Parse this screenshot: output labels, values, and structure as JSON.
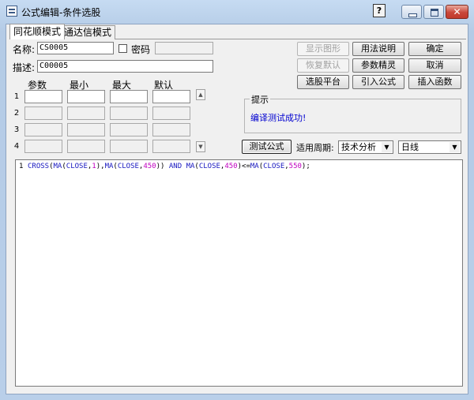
{
  "window": {
    "title": "公式编辑-条件选股",
    "help_label": "?",
    "close_label": "✕"
  },
  "tabs": [
    {
      "label": "同花顺模式",
      "active": true
    },
    {
      "label": "通达信模式",
      "active": false
    }
  ],
  "form": {
    "name_label": "名称:",
    "name_value": "CS0005",
    "password_label": "密码",
    "password_checked": false,
    "password_value": "",
    "desc_label": "描述:",
    "desc_value": "C00005"
  },
  "params": {
    "headers": [
      "参数",
      "最小",
      "最大",
      "默认"
    ],
    "rows": [
      {
        "num": "1",
        "values": [
          "",
          "",
          "",
          ""
        ],
        "enabled": true
      },
      {
        "num": "2",
        "values": [
          "",
          "",
          "",
          ""
        ],
        "enabled": false
      },
      {
        "num": "3",
        "values": [
          "",
          "",
          "",
          ""
        ],
        "enabled": false
      },
      {
        "num": "4",
        "values": [
          "",
          "",
          "",
          ""
        ],
        "enabled": false
      }
    ]
  },
  "buttons": {
    "show_graph": "显示图形",
    "restore_default": "恢复默认",
    "stock_platform": "选股平台",
    "usage": "用法说明",
    "param_wizard": "参数精灵",
    "import_formula": "引入公式",
    "ok": "确定",
    "cancel": "取消",
    "insert_function": "插入函数",
    "test_formula": "测试公式"
  },
  "hint": {
    "title": "提示",
    "message": "编译测试成功!"
  },
  "period": {
    "label": "适用周期:",
    "analysis_value": "技术分析",
    "cycle_value": "日线"
  },
  "editor": {
    "line_number": "1",
    "code_tokens": [
      {
        "t": "CROSS",
        "c": "kw"
      },
      {
        "t": "(",
        "c": "pn"
      },
      {
        "t": "MA",
        "c": "kw"
      },
      {
        "t": "(",
        "c": "pn"
      },
      {
        "t": "CLOSE",
        "c": "kw"
      },
      {
        "t": ",",
        "c": "pn"
      },
      {
        "t": "1",
        "c": "num"
      },
      {
        "t": "),",
        "c": "pn"
      },
      {
        "t": "MA",
        "c": "kw"
      },
      {
        "t": "(",
        "c": "pn"
      },
      {
        "t": "CLOSE",
        "c": "kw"
      },
      {
        "t": ",",
        "c": "pn"
      },
      {
        "t": "450",
        "c": "num"
      },
      {
        "t": ")) ",
        "c": "pn"
      },
      {
        "t": "AND",
        "c": "kw"
      },
      {
        "t": " ",
        "c": "pn"
      },
      {
        "t": "MA",
        "c": "kw"
      },
      {
        "t": "(",
        "c": "pn"
      },
      {
        "t": "CLOSE",
        "c": "kw"
      },
      {
        "t": ",",
        "c": "pn"
      },
      {
        "t": "450",
        "c": "num"
      },
      {
        "t": ")<=",
        "c": "pn"
      },
      {
        "t": "MA",
        "c": "kw"
      },
      {
        "t": "(",
        "c": "pn"
      },
      {
        "t": "CLOSE",
        "c": "kw"
      },
      {
        "t": ",",
        "c": "pn"
      },
      {
        "t": "550",
        "c": "num"
      },
      {
        "t": ");",
        "c": "pn"
      }
    ]
  },
  "colors": {
    "hint_text": "#0000d0",
    "code_keyword": "#1818c0",
    "code_number": "#c000c0",
    "close_button": "#c9473a"
  }
}
